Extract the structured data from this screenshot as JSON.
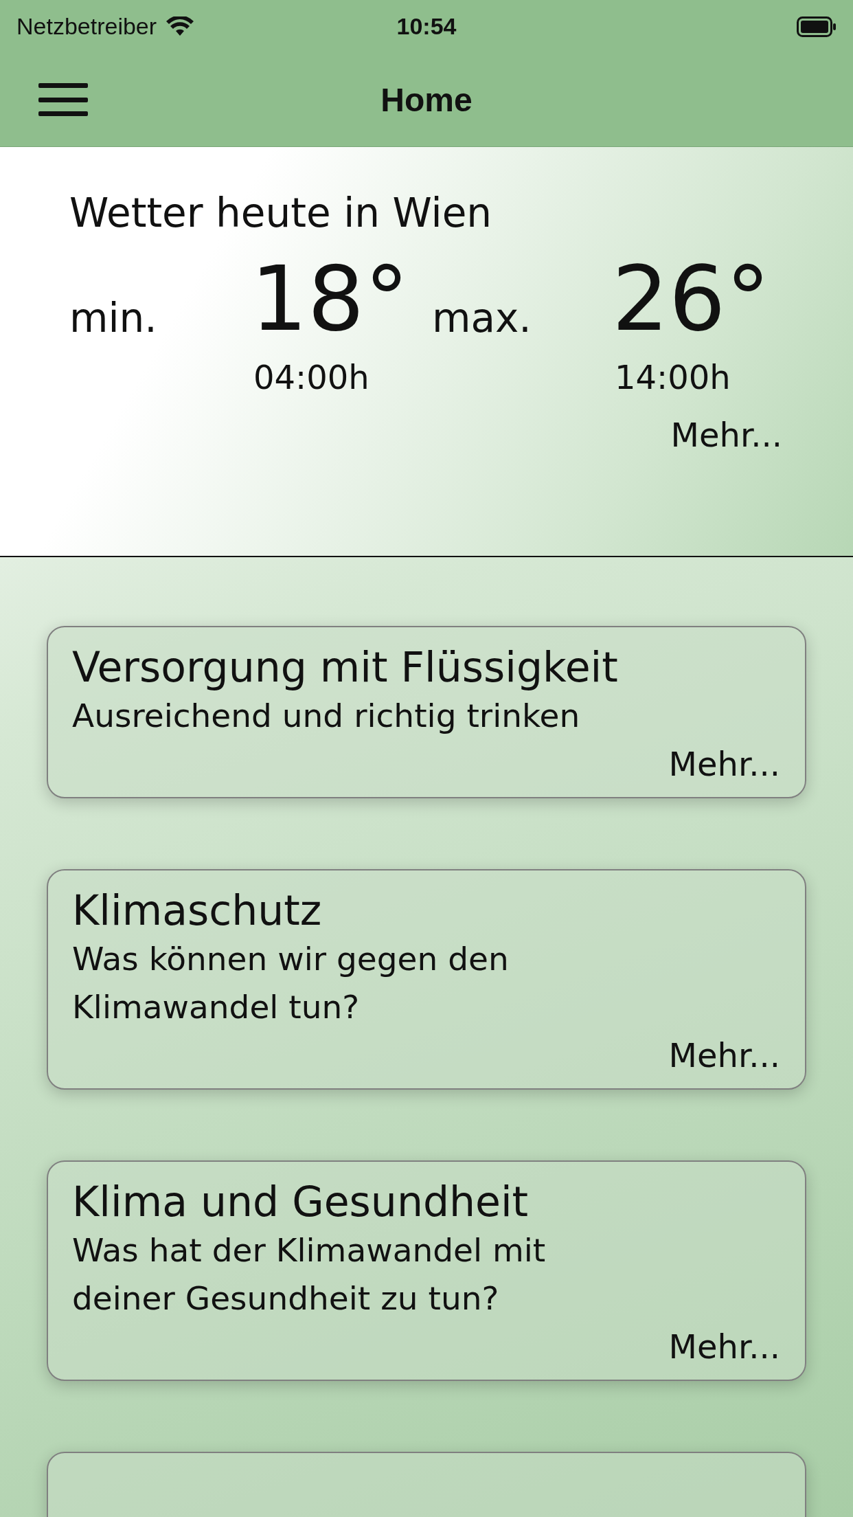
{
  "status_bar": {
    "carrier": "Netzbetreiber",
    "time": "10:54"
  },
  "nav_bar": {
    "title": "Home"
  },
  "weather": {
    "title": "Wetter heute in Wien",
    "min_label": "min.",
    "min_value": "18°",
    "min_time": "04:00h",
    "max_label": "max.",
    "max_value": "26°",
    "max_time": "14:00h",
    "more": "Mehr..."
  },
  "cards": [
    {
      "kind": "topic",
      "title": "Versorgung mit Flüssigkeit",
      "subtitle": "Ausreichend und richtig trinken",
      "more": "Mehr..."
    },
    {
      "kind": "topic",
      "title": "Klimaschutz",
      "subtitle": "Was können wir gegen den Klimawandel tun?",
      "more": "Mehr..."
    },
    {
      "kind": "topic",
      "title": "Klima und Gesundheit",
      "subtitle": "Was hat der Klimawandel mit deiner Gesundheit zu tun?",
      "more": "Mehr..."
    },
    {
      "kind": "partial"
    }
  ]
}
